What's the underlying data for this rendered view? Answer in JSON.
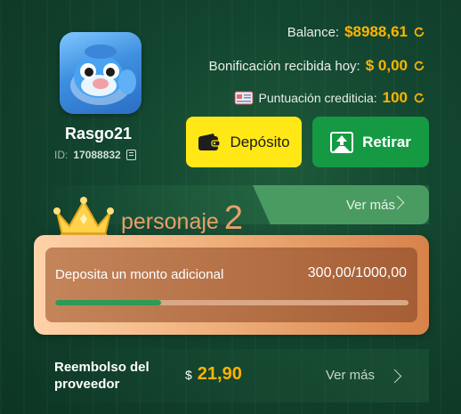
{
  "profile": {
    "username": "Rasgo21",
    "id_label": "ID:",
    "id_value": "17088832"
  },
  "stats": {
    "balance_label": "Balance:",
    "balance_value": "$8988,61",
    "bonus_label": "Bonificación recibida hoy:",
    "bonus_value": "$ 0,00",
    "credit_label": "Puntuación crediticia:",
    "credit_value": "100"
  },
  "actions": {
    "deposit_label": "Depósito",
    "withdraw_label": "Retirar"
  },
  "vip": {
    "tier_word": "personaje",
    "tier_number": "2",
    "more_label": "Ver más"
  },
  "progress": {
    "label": "Deposita un monto adicional",
    "value_text": "300,00/1000,00",
    "fraction": 0.3
  },
  "rebate": {
    "label_line1": "Reembolso del",
    "label_line2": "proveedor",
    "currency": "$",
    "amount": "21,90",
    "more_label": "Ver más"
  },
  "colors": {
    "accent_gold": "#ffb400",
    "deposit_yellow": "#ffe815",
    "withdraw_green": "#159a43",
    "progress_green": "#2e9a56"
  }
}
